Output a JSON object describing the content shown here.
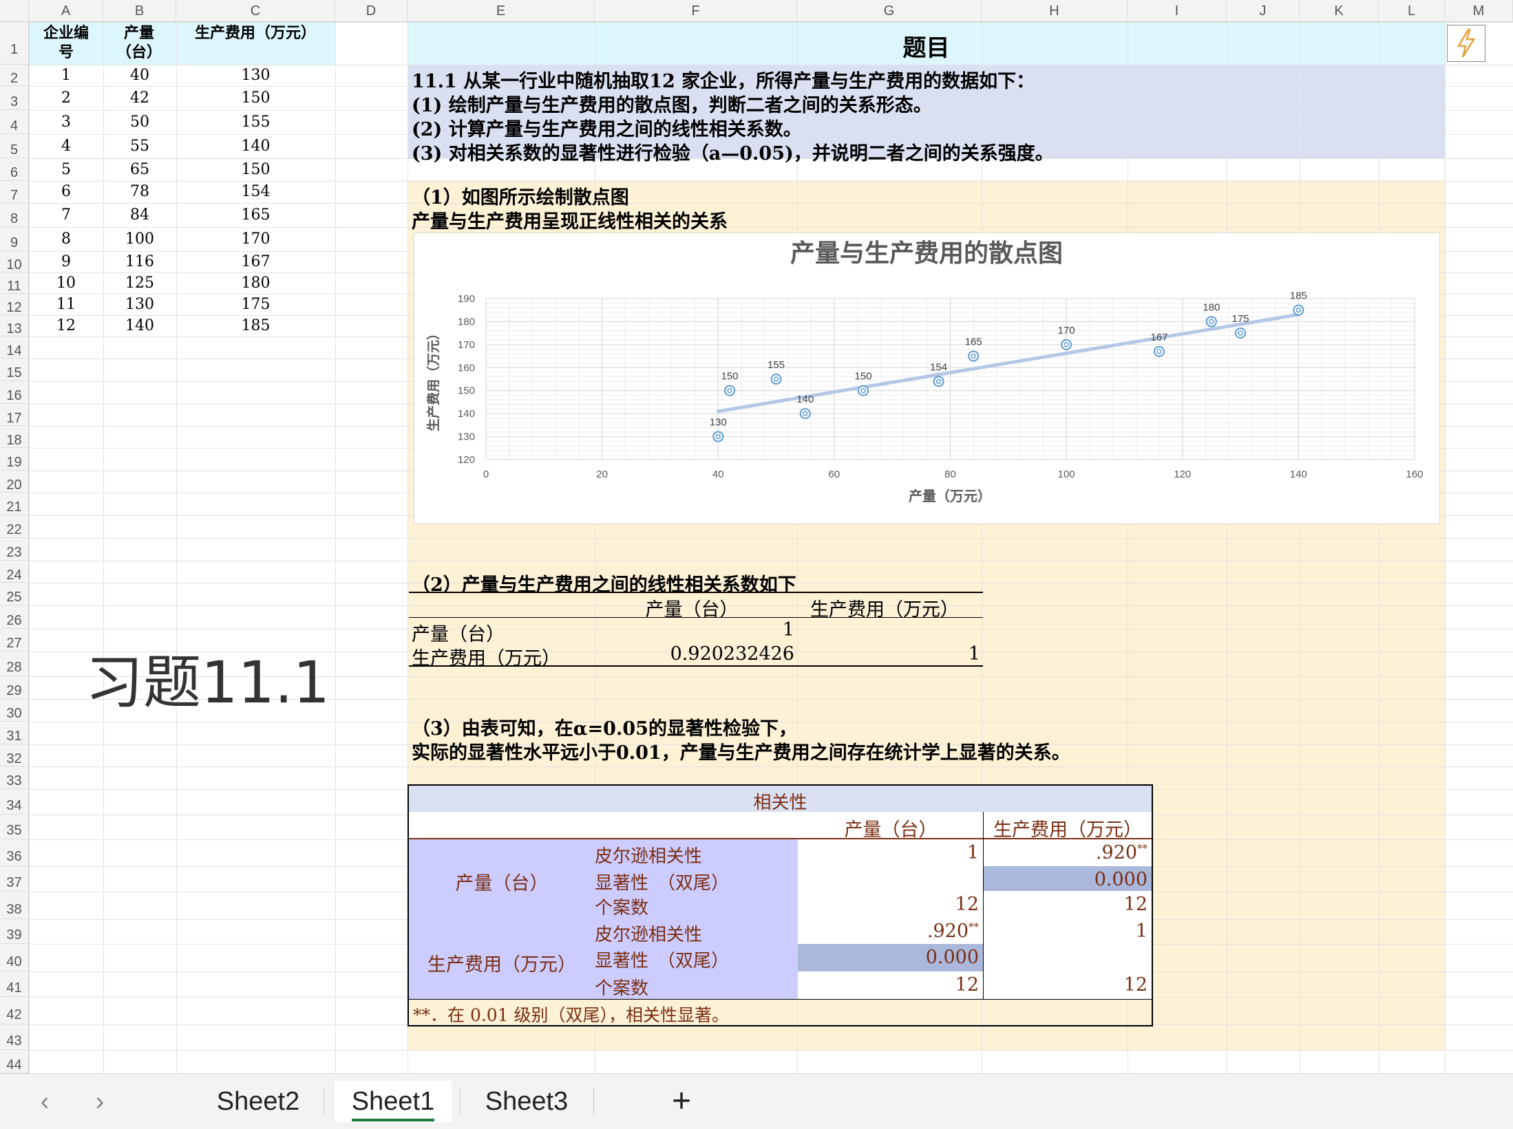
{
  "columns": [
    "A",
    "B",
    "C",
    "D",
    "E",
    "F",
    "G",
    "H",
    "I",
    "J",
    "K",
    "L",
    "M"
  ],
  "rows": [
    "1",
    "2",
    "3",
    "4",
    "5",
    "6",
    "7",
    "8",
    "9",
    "10",
    "11",
    "12",
    "13",
    "14",
    "15",
    "16",
    "17",
    "18",
    "19",
    "20",
    "21",
    "22",
    "23",
    "24",
    "25",
    "26",
    "27",
    "28",
    "29",
    "30",
    "31",
    "32",
    "33",
    "34",
    "35",
    "36",
    "37",
    "38",
    "39",
    "40",
    "41",
    "42",
    "43",
    "44"
  ],
  "data_table": {
    "headers": {
      "id": "企业编号",
      "output": "产量（台）",
      "cost": "生产费用（万元）"
    },
    "header_lines": {
      "id": [
        "企业编",
        "号"
      ],
      "output": [
        "产量",
        "（台）"
      ],
      "cost": [
        "生产费用（万元）"
      ]
    },
    "rows": [
      {
        "id": "1",
        "output": "40",
        "cost": "130"
      },
      {
        "id": "2",
        "output": "42",
        "cost": "150"
      },
      {
        "id": "3",
        "output": "50",
        "cost": "155"
      },
      {
        "id": "4",
        "output": "55",
        "cost": "140"
      },
      {
        "id": "5",
        "output": "65",
        "cost": "150"
      },
      {
        "id": "6",
        "output": "78",
        "cost": "154"
      },
      {
        "id": "7",
        "output": "84",
        "cost": "165"
      },
      {
        "id": "8",
        "output": "100",
        "cost": "170"
      },
      {
        "id": "9",
        "output": "116",
        "cost": "167"
      },
      {
        "id": "10",
        "output": "125",
        "cost": "180"
      },
      {
        "id": "11",
        "output": "130",
        "cost": "175"
      },
      {
        "id": "12",
        "output": "140",
        "cost": "185"
      }
    ]
  },
  "exercise_label": "习题11.1",
  "problem": {
    "title": "题目",
    "lines": [
      "11.1 从某一行业中随机抽取12 家企业，所得产量与生产费用的数据如下：",
      "(1) 绘制产量与生产费用的散点图，判断二者之间的关系形态。",
      "(2) 计算产量与生产费用之间的线性相关系数。",
      "(3) 对相关系数的显著性进行检验（a—0.05)，并说明二者之间的关系强度。"
    ]
  },
  "part1": {
    "heading": "（1）如图所示绘制散点图",
    "conclusion": "产量与生产费用呈现正线性相关的关系"
  },
  "chart_data": {
    "type": "scatter",
    "title": "产量与生产费用的散点图",
    "xlabel": "产量（万元）",
    "ylabel": "生产费用（万元）",
    "xlim": [
      0,
      160
    ],
    "ylim": [
      120,
      190
    ],
    "xticks": [
      "0",
      "20",
      "40",
      "60",
      "80",
      "100",
      "120",
      "140",
      "160"
    ],
    "yticks": [
      "120",
      "130",
      "140",
      "150",
      "160",
      "170",
      "180",
      "190"
    ],
    "x": [
      40,
      42,
      50,
      55,
      65,
      78,
      84,
      100,
      116,
      125,
      130,
      140
    ],
    "y": [
      130,
      150,
      155,
      140,
      150,
      154,
      165,
      170,
      167,
      180,
      175,
      185
    ],
    "trendline": true,
    "data_labels": true,
    "grid": true,
    "colors": {
      "marker": "#5b9bd5",
      "trend": "#b4c7e7"
    }
  },
  "part2": {
    "heading": "（2）产量与生产费用之间的线性相关系数如下",
    "col_output": "产量（台）",
    "col_cost": "生产费用（万元）",
    "row_output": "产量（台）",
    "row_cost": "生产费用（万元）",
    "r11": "1",
    "r21": "0.920232426",
    "r22": "1"
  },
  "part3": {
    "line1": "（3）由表可知，在α=0.05的显著性检验下，",
    "line2": "实际的显著性水平远小于0.01，产量与生产费用之间存在统计学上显著的关系。"
  },
  "spss": {
    "title": "相关性",
    "col1": "产量（台）",
    "col2": "生产费用（万元）",
    "group1": "产量（台）",
    "group2": "生产费用（万元）",
    "stat_pearson": "皮尔逊相关性",
    "stat_sig": "显著性　（双尾）",
    "stat_n": "个案数",
    "g1_pearson_c1": "1",
    "g1_pearson_c2": ".920",
    "g1_sig_c2": "0.000",
    "g1_n_c1": "12",
    "g1_n_c2": "12",
    "g2_pearson_c1": ".920",
    "g2_pearson_c2": "1",
    "g2_sig_c1": "0.000",
    "g2_n_c1": "12",
    "g2_n_c2": "12",
    "sup": "**",
    "footnote": "**．在 0.01 级别（双尾），相关性显著。"
  },
  "tabs": [
    "Sheet2",
    "Sheet1",
    "Sheet3"
  ],
  "active_tab": "Sheet1",
  "add_sheet": "+",
  "nav_prev": "‹",
  "nav_next": "›",
  "colors": {
    "title_fill": "#ddf6fb",
    "problem_fill": "#dae0f2",
    "answer_fill": "#fdf1d6",
    "spss_left_fill": "#ccccff",
    "spss_sig_fill": "#aab8dc",
    "spss_text": "#7a2e12"
  }
}
